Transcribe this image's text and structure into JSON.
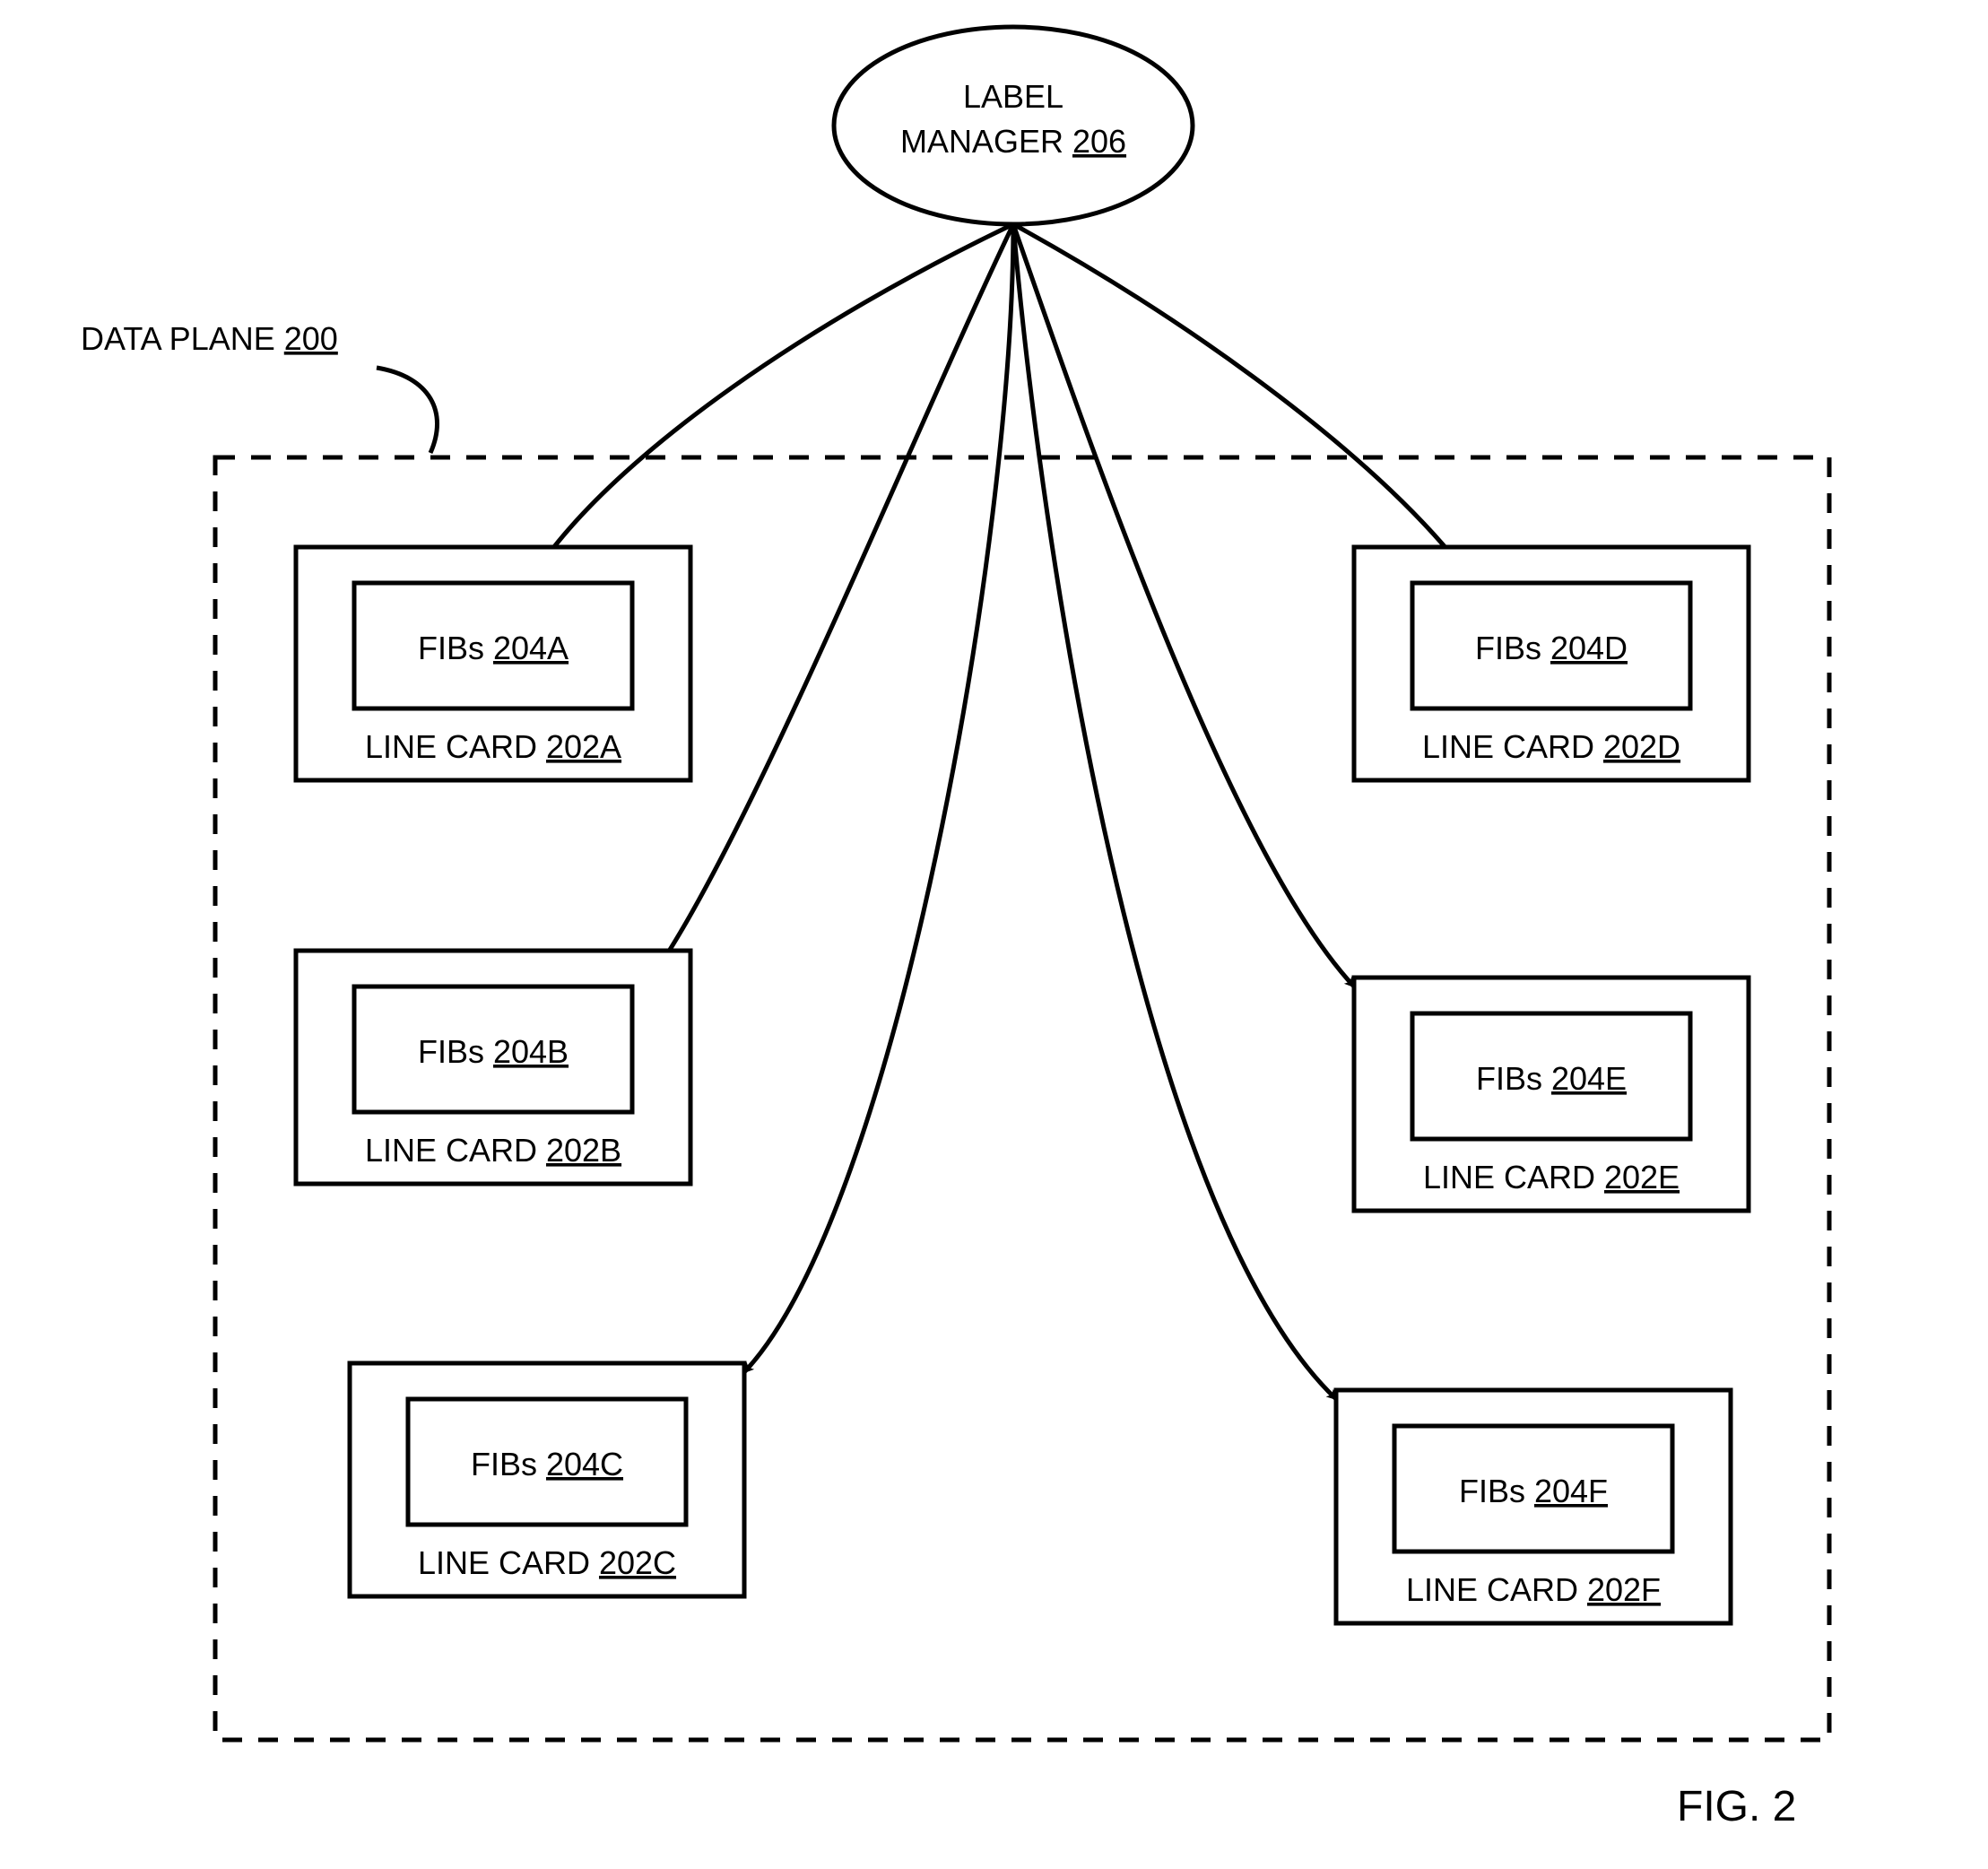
{
  "manager": {
    "title_line1": "LABEL",
    "title_line2": "MANAGER ",
    "ref": "206"
  },
  "plane": {
    "label": "DATA PLANE ",
    "ref": "200"
  },
  "cards": {
    "a": {
      "fib_label": "FIBs ",
      "fib_ref": "204A",
      "card_label": "LINE CARD ",
      "card_ref": "202A"
    },
    "b": {
      "fib_label": "FIBs ",
      "fib_ref": "204B",
      "card_label": "LINE CARD ",
      "card_ref": "202B"
    },
    "c": {
      "fib_label": "FIBs ",
      "fib_ref": "204C",
      "card_label": "LINE CARD ",
      "card_ref": "202C"
    },
    "d": {
      "fib_label": "FIBs ",
      "fib_ref": "204D",
      "card_label": "LINE CARD ",
      "card_ref": "202D"
    },
    "e": {
      "fib_label": "FIBs ",
      "fib_ref": "204E",
      "card_label": "LINE CARD ",
      "card_ref": "202E"
    },
    "f": {
      "fib_label": "FIBs ",
      "fib_ref": "204F",
      "card_label": "LINE CARD ",
      "card_ref": "202F"
    }
  },
  "figure": "FIG. 2"
}
